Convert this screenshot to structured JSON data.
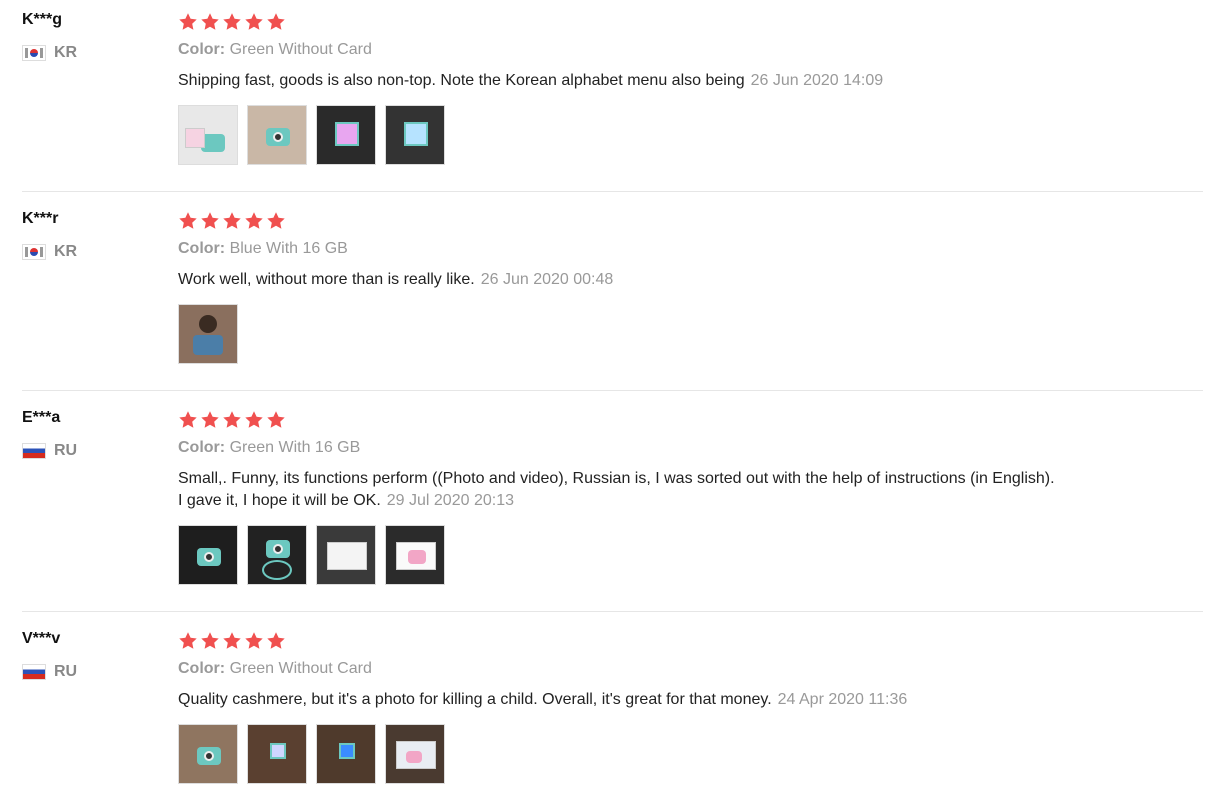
{
  "reviews": [
    {
      "user": "K***g",
      "country": "KR",
      "rating": 5,
      "color_label": "Color:",
      "color_value": "Green Without Card",
      "comment": "Shipping fast, goods is also non-top. Note the Korean alphabet menu also being",
      "date": "26 Jun 2020 14:09",
      "photos": [
        "camera-on-white",
        "camera-in-hand",
        "camera-screen-lit",
        "camera-screen-dark"
      ]
    },
    {
      "user": "K***r",
      "country": "KR",
      "rating": 5,
      "color_label": "Color:",
      "color_value": "Blue With 16 GB",
      "comment": "Work well, without more than is really like.",
      "date": "26 Jun 2020 00:48",
      "photos": [
        "child-with-camera"
      ]
    },
    {
      "user": "E***a",
      "country": "RU",
      "rating": 5,
      "color_label": "Color:",
      "color_value": "Green With 16 GB",
      "comment": "Small,. Funny, its functions perform ((Photo and video), Russian is, I was sorted out with the help of instructions (in English). I gave it, I hope it will be OK.",
      "date": "29 Jul 2020 20:13",
      "photos": [
        "camera-dark-bg",
        "camera-with-strap",
        "instruction-booklet",
        "camera-box"
      ]
    },
    {
      "user": "V***v",
      "country": "RU",
      "rating": 5,
      "color_label": "Color:",
      "color_value": "Green Without Card",
      "comment": "Quality cashmere, but it's a photo for killing a child. Overall, it's great for that money.",
      "date": "24 Apr 2020 11:36",
      "photos": [
        "camera-in-hand",
        "camera-screen-on",
        "camera-screen-blue",
        "camera-box"
      ]
    }
  ],
  "colors": {
    "star": "#f0504f",
    "muted_text": "#999999",
    "divider": "#e6e6e6"
  },
  "icons": {
    "star": "star-icon",
    "flag_kr": "south-korea-flag-icon",
    "flag_ru": "russia-flag-icon"
  }
}
